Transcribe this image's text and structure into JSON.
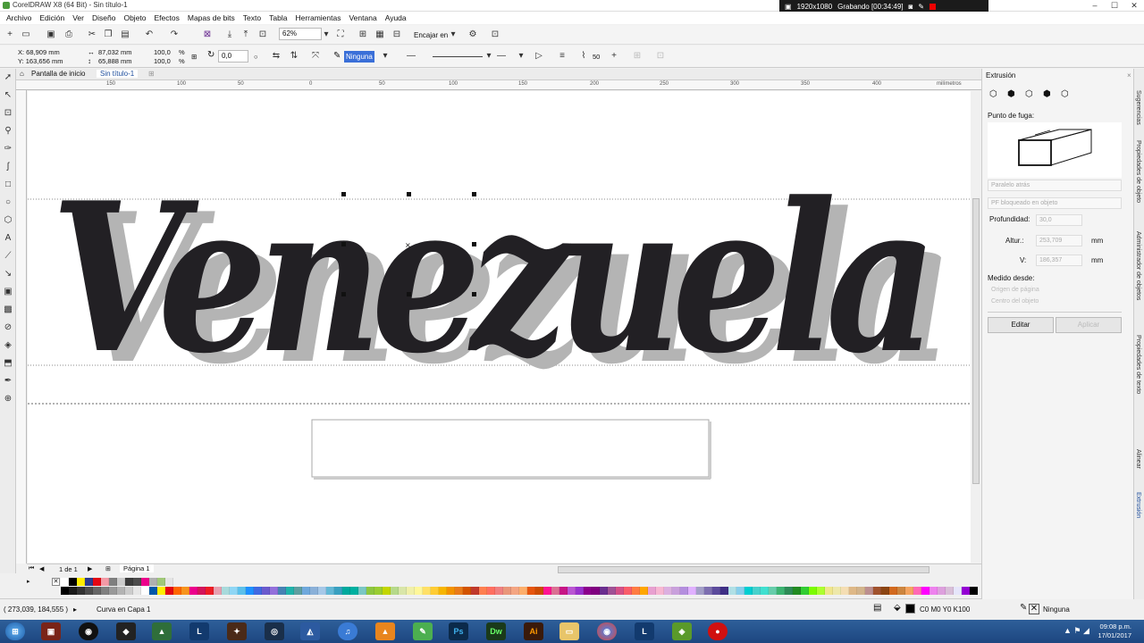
{
  "window": {
    "title": "CorelDRAW X8 (64 Bit) - Sin título-1",
    "recorder": {
      "resolution": "1920x1080",
      "status": "Grabando [00:34:49]"
    }
  },
  "menu": [
    "Archivo",
    "Edición",
    "Ver",
    "Diseño",
    "Objeto",
    "Efectos",
    "Mapas de bits",
    "Texto",
    "Tabla",
    "Herramientas",
    "Ventana",
    "Ayuda"
  ],
  "toolbar": {
    "zoom": "62%",
    "snap_label": "Encajar en"
  },
  "propbar": {
    "x": "X: 68,909 mm",
    "y": "Y: 163,656 mm",
    "w": "87,032 mm",
    "h": "65,888 mm",
    "sx": "100,0",
    "sy": "100,0",
    "pct": "%",
    "angle": "0,0",
    "outline": "Ninguna",
    "step": "50"
  },
  "tabs": [
    "Pantalla de inicio",
    "Sin título-1"
  ],
  "ruler": {
    "unit": "milímetros",
    "h_ticks": [
      "150",
      "100",
      "50",
      "0",
      "50",
      "100",
      "150",
      "200",
      "250",
      "300",
      "350",
      "400"
    ]
  },
  "artwork": {
    "word": "Venezuela",
    "fill": "#222024",
    "shadow": "#b4b4b4"
  },
  "pagenav": {
    "counter": "1 de 1",
    "page": "Página 1"
  },
  "palette_colors": [
    "#ffffff",
    "#000000",
    "#ffed00",
    "#2b3a8f",
    "#e30613",
    "#f39aa6",
    "#7f7f7f",
    "#cccccc",
    "#3b3b3b",
    "#4c4c4c",
    "#ec008c",
    "#b0b0b0",
    "#a0c878",
    "#e4e4e4"
  ],
  "palette_row2": [
    "#000000",
    "#1a1a1a",
    "#333333",
    "#4d4d4d",
    "#666666",
    "#808080",
    "#999999",
    "#b3b3b3",
    "#cccccc",
    "#e6e6e6",
    "#ffffff",
    "#0057a8",
    "#ffed00",
    "#e30613",
    "#ff6600",
    "#f7941d",
    "#ec008c",
    "#d4145a",
    "#ed1c24",
    "#e7a0b0",
    "#a8dadc",
    "#8fd6f5",
    "#5bc0eb",
    "#1e90ff",
    "#4169e1",
    "#6a5acd",
    "#9370db",
    "#4682b4",
    "#20b2aa",
    "#5f9ea0",
    "#6fa8dc",
    "#8ab0d8",
    "#a6c8e8",
    "#63b8d6",
    "#39a0c0",
    "#00a99d",
    "#00b0a0",
    "#7ac7c4",
    "#8dc63f",
    "#9acd32",
    "#c3d600",
    "#b6d98a",
    "#d9e6a8",
    "#f1f0a8",
    "#fff799",
    "#ffe066",
    "#ffcc33",
    "#f7b500",
    "#f39200",
    "#e97b1a",
    "#d35400",
    "#c0392b",
    "#ff7f50",
    "#ff6f61",
    "#f08080",
    "#e9967a",
    "#f4a582",
    "#fdae6b",
    "#e6550d",
    "#cc4c02",
    "#ff1493",
    "#db7093",
    "#c71585",
    "#ba55d3",
    "#9932cc",
    "#8b008b",
    "#800080",
    "#6b2e8f",
    "#a05195",
    "#d45087",
    "#f95d6a",
    "#ff7c43",
    "#ffa600",
    "#e8a0d0",
    "#f7b7d2",
    "#dcb0e0",
    "#c9a0dc",
    "#b48ede",
    "#e0b0ff",
    "#a39fc8",
    "#7d6fb0",
    "#5c4b9c",
    "#3f2f85",
    "#b0e0e6",
    "#87ceeb",
    "#00ced1",
    "#48d1cc",
    "#40e0d0",
    "#66cdaa",
    "#3cb371",
    "#2e8b57",
    "#228b22",
    "#32cd32",
    "#7cfc00",
    "#adff2f",
    "#f0e68c",
    "#eee8aa",
    "#f5deb3",
    "#deb887",
    "#d2b48c",
    "#bc8f8f",
    "#a0522d",
    "#8b4513",
    "#d2691e",
    "#cd853f",
    "#f4a460",
    "#ff69b4",
    "#ff00ff",
    "#ee82ee",
    "#dda0dd",
    "#d8bfd8",
    "#e6e6fa",
    "#9400d3",
    "#000000"
  ],
  "status": {
    "coords": "( 273,039, 184,555 )",
    "message": "Curva en Capa 1",
    "fill_info": "C0 M0 Y0 K100",
    "outline_info": "Ninguna"
  },
  "docker": {
    "title": "Extrusión",
    "vanishing_label": "Punto de fuga:",
    "select1": "Paralelo atrás",
    "select2": "PF bloqueado en objeto",
    "depth_label": "Profundidad:",
    "depth_value": "30,0",
    "h_label": "Altur.:",
    "h_value": "253,709",
    "v_label": "V:",
    "v_value": "186,357",
    "unit": "mm",
    "measured_label": "Medido desde:",
    "radio1": "Origen de página",
    "radio2": "Centro del objeto",
    "edit_button": "Editar",
    "apply_button": "Aplicar"
  },
  "side_tabs": [
    "Sugerencias",
    "Propiedades de objeto",
    "Administrador de objetos",
    "Propiedades de texto",
    "Alinear",
    "Extrusión"
  ],
  "clock": {
    "time": "09:08 p.m.",
    "date": "17/01/2017"
  }
}
